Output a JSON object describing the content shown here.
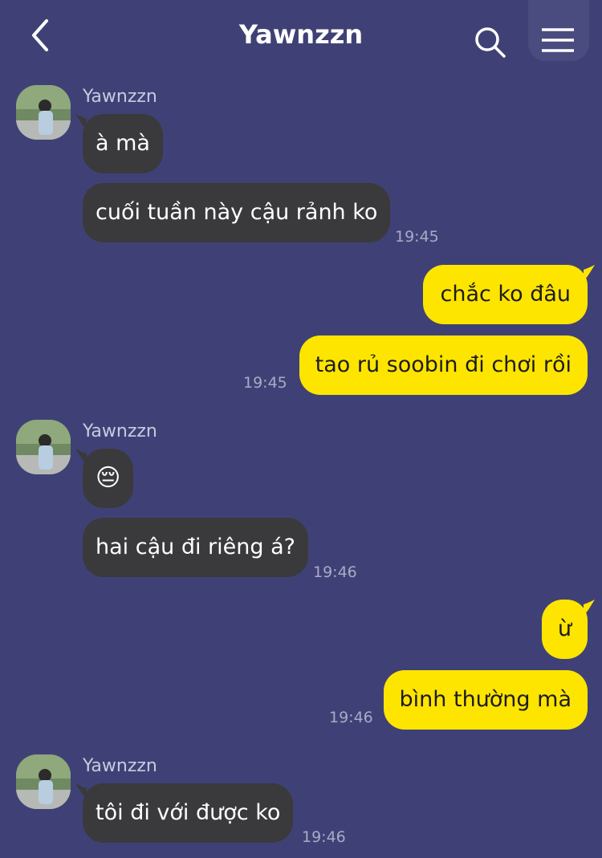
{
  "header": {
    "title": "Yawnzzn"
  },
  "colors": {
    "background": "#3f4176",
    "incoming_bubble": "#3a3a3c",
    "outgoing_bubble": "#fee500"
  },
  "messages": [
    {
      "sender": "Yawnzzn",
      "text": "à mà"
    },
    {
      "text": "cuối tuần này cậu rảnh ko",
      "time": "19:45"
    },
    {
      "text": "chắc ko đâu"
    },
    {
      "text": "tao rủ soobin đi chơi rồi",
      "time": "19:45"
    },
    {
      "sender": "Yawnzzn",
      "text": "😔"
    },
    {
      "text": "hai cậu đi riêng á?",
      "time": "19:46"
    },
    {
      "text": "ừ"
    },
    {
      "text": "bình thường mà",
      "time": "19:46"
    },
    {
      "sender": "Yawnzzn",
      "text": "tôi đi với được ko",
      "time": "19:46"
    }
  ]
}
